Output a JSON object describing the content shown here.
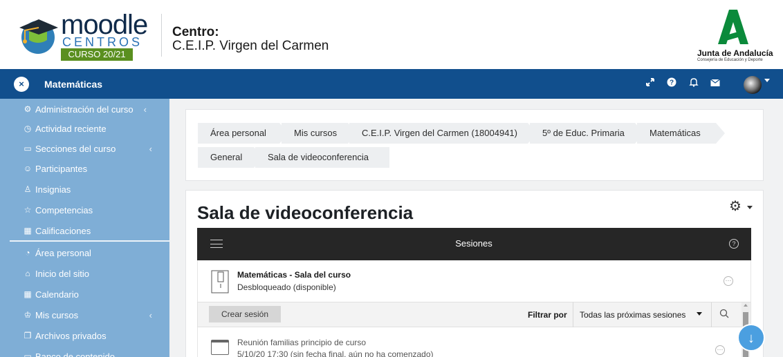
{
  "header": {
    "logo": {
      "word": "moodle",
      "sub": "CENTROS",
      "badge": "CURSO 20/21"
    },
    "centro_label": "Centro:",
    "centro_name": "C.E.I.P. Virgen del Carmen",
    "junta_name": "Junta de Andalucía",
    "junta_sub": "Consejería de Educación y Deporte",
    "colors": {
      "brand_green": "#5a8f1f",
      "navbar": "#114f8d",
      "junta_green": "#0b8a3b"
    }
  },
  "navbar": {
    "close": "×",
    "title": "Matemáticas",
    "icons": [
      "fullscreen-icon",
      "help-icon",
      "bell-icon",
      "envelope-icon"
    ],
    "avatar": "user-avatar"
  },
  "sidebar": {
    "items": [
      {
        "label": "Administración del curso",
        "icon": "⚙",
        "arrow": "‹"
      },
      {
        "label": "Actividad reciente",
        "icon": "◷",
        "arrow": ""
      },
      {
        "label": "Secciones del curso",
        "icon": "▭",
        "arrow": "‹"
      },
      {
        "label": "Participantes",
        "icon": "☺",
        "arrow": ""
      },
      {
        "label": "Insignias",
        "icon": "♙",
        "arrow": ""
      },
      {
        "label": "Competencias",
        "icon": "☆",
        "arrow": ""
      },
      {
        "label": "Calificaciones",
        "icon": "▦",
        "arrow": ""
      },
      {
        "label": "Área personal",
        "icon": "◔",
        "arrow": ""
      },
      {
        "label": "Inicio del sitio",
        "icon": "⌂",
        "arrow": ""
      },
      {
        "label": "Calendario",
        "icon": "▦",
        "arrow": ""
      },
      {
        "label": "Mis cursos",
        "icon": "♔",
        "arrow": "‹"
      },
      {
        "label": "Archivos privados",
        "icon": "❐",
        "arrow": ""
      },
      {
        "label": "Banco de contenido",
        "icon": "▭",
        "arrow": ""
      }
    ]
  },
  "breadcrumb": [
    "Área personal",
    "Mis cursos",
    "C.E.I.P. Virgen del Carmen (18004941)",
    "5º de Educ. Primaria",
    "Matemáticas",
    "General",
    "Sala de videoconferencia"
  ],
  "main": {
    "heading": "Sala de videoconferencia",
    "settings_icon": "⚙",
    "sessions_title": "Sesiones",
    "help": "?",
    "room": {
      "title": "Matemáticas - Sala del curso",
      "status": "Desbloqueado (disponible)"
    },
    "toolbar": {
      "create_label": "Crear sesión",
      "filter_label": "Filtrar por",
      "filter_value": "Todas las próximas sesiones"
    },
    "session": {
      "title": "Reunión familias principio de curso",
      "date": "5/10/20 17:30 (sin fecha final, aún no ha comenzado)"
    },
    "more": "⋯",
    "fab": "↓"
  }
}
